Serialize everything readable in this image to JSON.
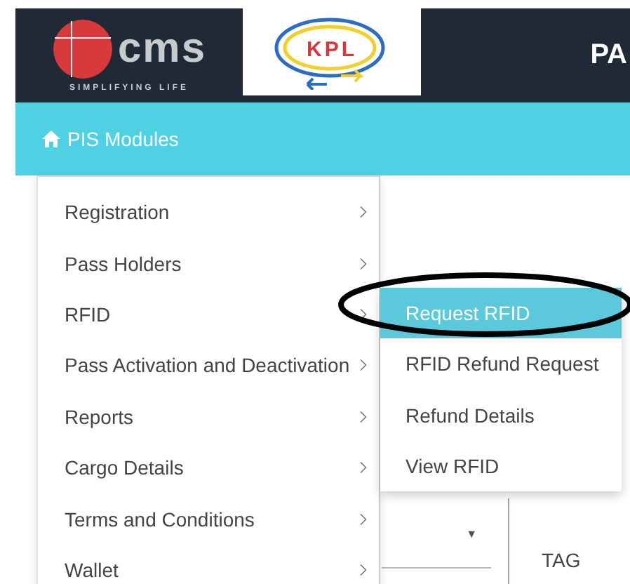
{
  "header": {
    "cms_logo": {
      "wordmark": "cms",
      "tagline": "SIMPLIFYING LIFE"
    },
    "kpl_logo": {
      "wordmark": "KPL"
    },
    "title": "PA"
  },
  "nav": {
    "label": "PIS Modules"
  },
  "menu": {
    "items": [
      {
        "label": "Registration"
      },
      {
        "label": "Pass Holders"
      },
      {
        "label": "RFID",
        "children": [
          {
            "label": "Request RFID",
            "selected": true
          },
          {
            "label": "RFID Refund Request",
            "selected": false
          },
          {
            "label": "Refund Details",
            "selected": false
          },
          {
            "label": "View RFID",
            "selected": false
          }
        ]
      },
      {
        "label": "Pass Activation and Deactivation"
      },
      {
        "label": "Reports"
      },
      {
        "label": "Cargo Details"
      },
      {
        "label": "Terms and Conditions"
      },
      {
        "label": "Wallet"
      }
    ]
  },
  "background": {
    "select_caret": "▼",
    "column_header": "TAG"
  }
}
